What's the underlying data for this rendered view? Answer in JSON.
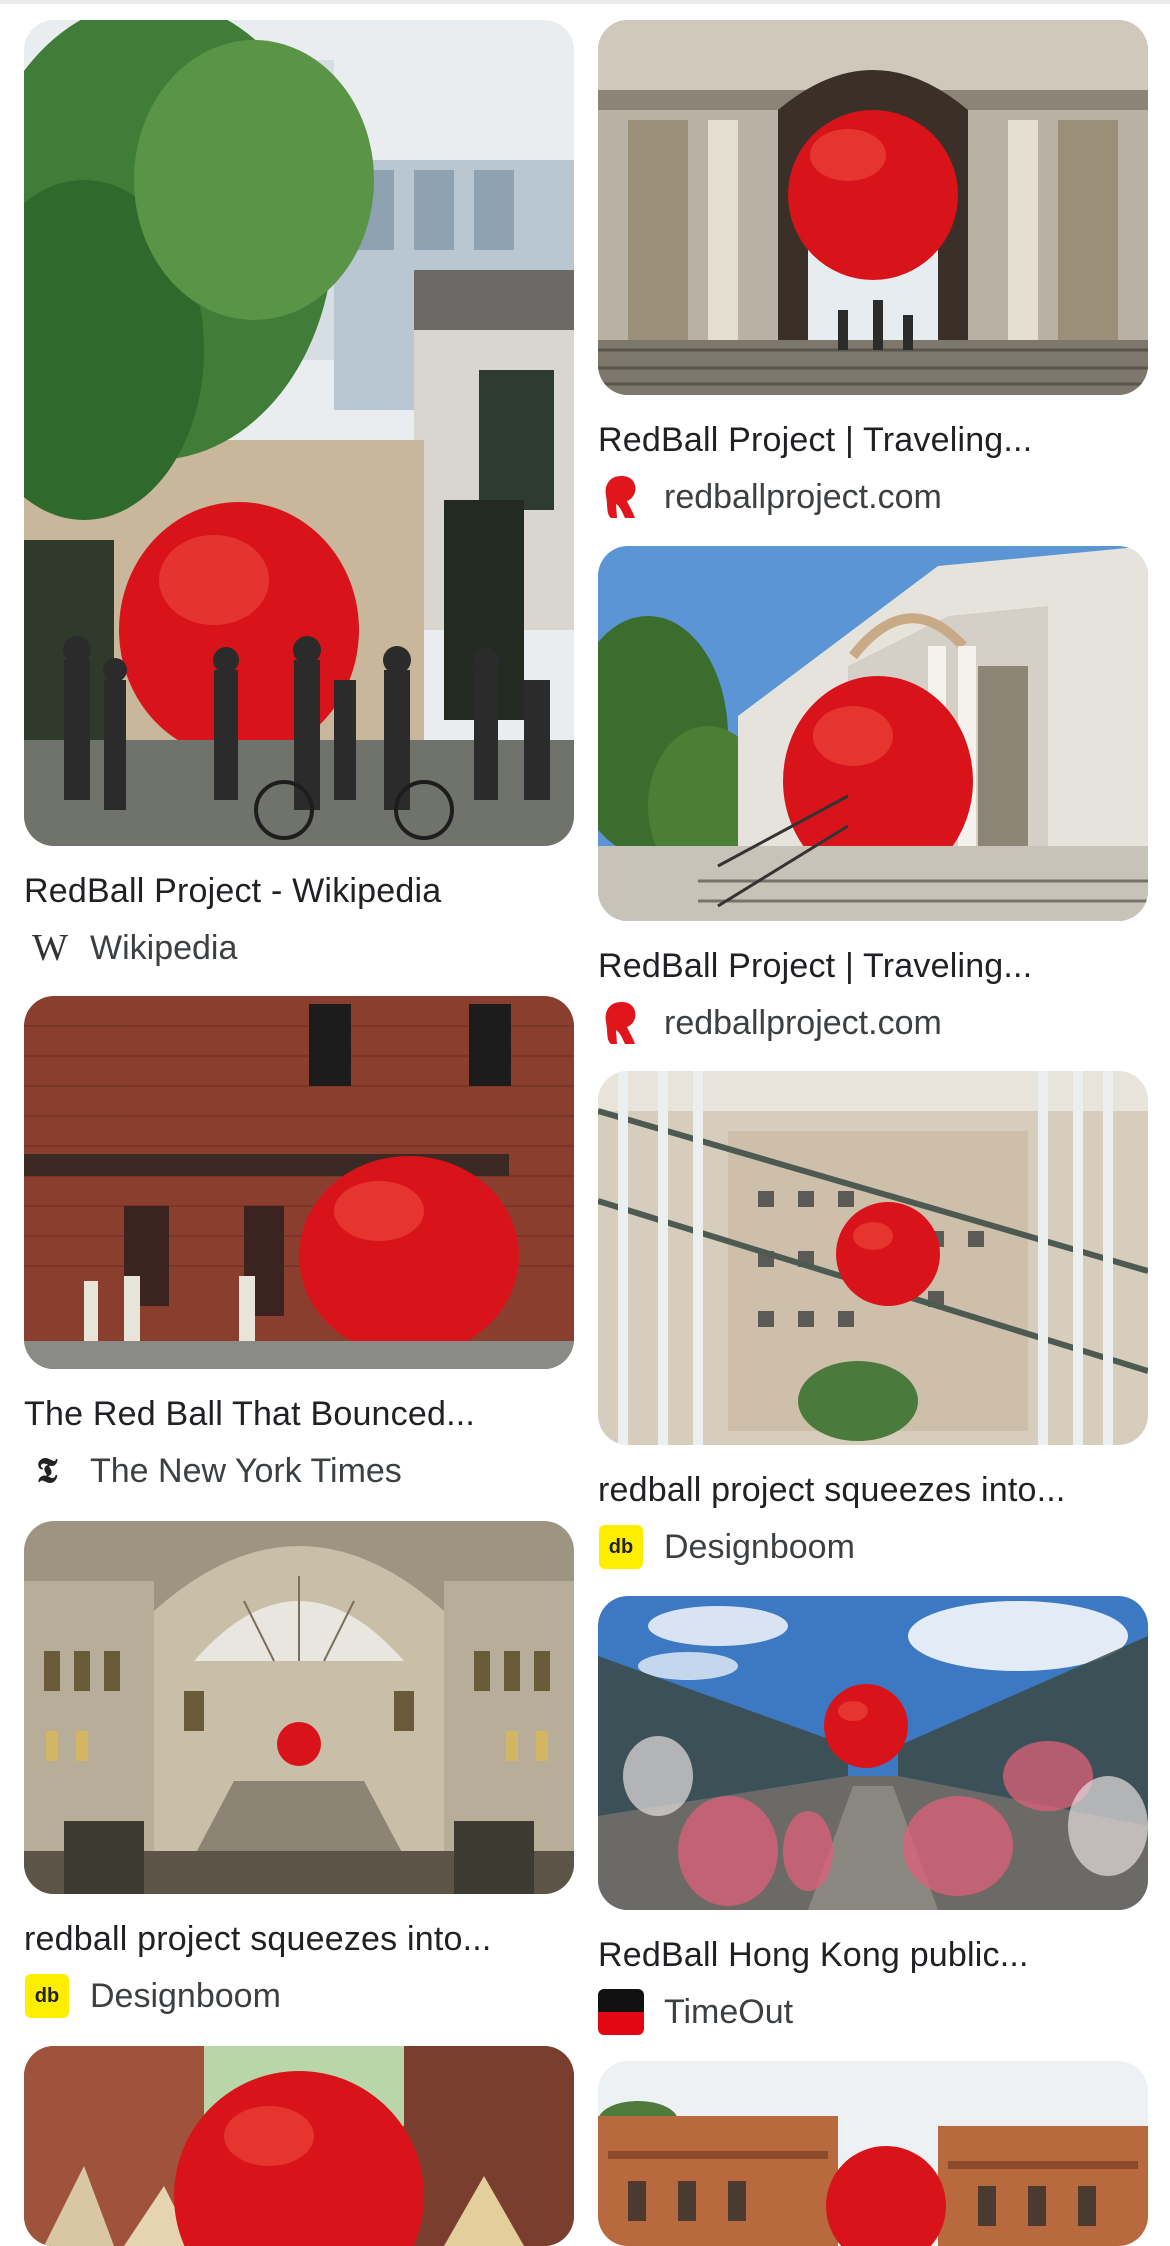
{
  "results": [
    {
      "title": "RedBall Project - Wikipedia",
      "source": "Wikipedia",
      "favicon": "wikipedia-icon"
    },
    {
      "title": "RedBall Project | Traveling...",
      "source": "redballproject.com",
      "favicon": "redball-icon"
    },
    {
      "title": "RedBall Project | Traveling...",
      "source": "redballproject.com",
      "favicon": "redball-icon"
    },
    {
      "title": "The Red Ball That Bounced...",
      "source": "The New York Times",
      "favicon": "nyt-icon"
    },
    {
      "title": "redball project squeezes into...",
      "source": "Designboom",
      "favicon": "designboom-icon"
    },
    {
      "title": "redball project squeezes into...",
      "source": "Designboom",
      "favicon": "designboom-icon"
    },
    {
      "title": "RedBall Hong Kong public...",
      "source": "TimeOut",
      "favicon": "timeout-icon"
    }
  ],
  "favicons": {
    "designboom_text": "db"
  },
  "colors": {
    "ball": "#d8141a",
    "designboom_yellow": "#ffee00",
    "timeout_red": "#e30613"
  }
}
